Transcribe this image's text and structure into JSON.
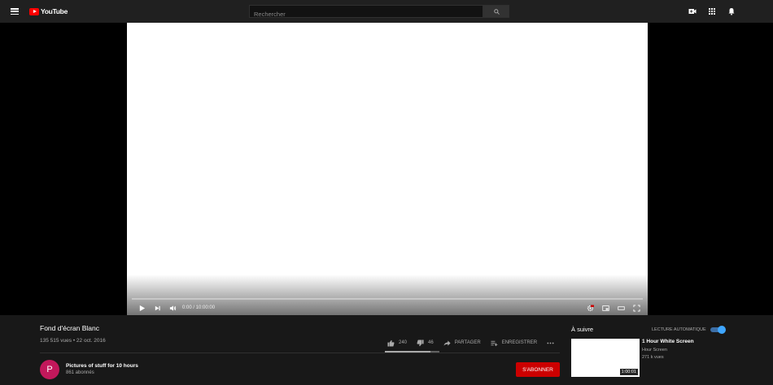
{
  "header": {
    "logo_text": "YouTube",
    "search_placeholder": "Rechercher"
  },
  "player": {
    "time": "0:00 / 10:00:00",
    "progress": 0
  },
  "video": {
    "title": "Fond d'écran Blanc",
    "meta": "135 515 vues • 22 oct. 2016",
    "likes": "240",
    "dislikes": "46",
    "share_label": "PARTAGER",
    "save_label": "ENREGISTRER"
  },
  "channel": {
    "avatar_letter": "P",
    "name": "Pictures of stuff for 10 hours",
    "subs": "861 abonnés",
    "subscribe_label": "S'ABONNER"
  },
  "sidebar": {
    "up_next": "À suivre",
    "autoplay_label": "LECTURE AUTOMATIQUE",
    "autoplay_on": true,
    "next": {
      "title": "1 Hour White Screen",
      "channel": "Hour Screen",
      "views": "271 k vues",
      "duration": "1:00:01"
    }
  },
  "colors": {
    "accent_red": "#ff0000",
    "subscribe_red": "#cc0000",
    "toggle_blue": "#3ea6ff"
  }
}
